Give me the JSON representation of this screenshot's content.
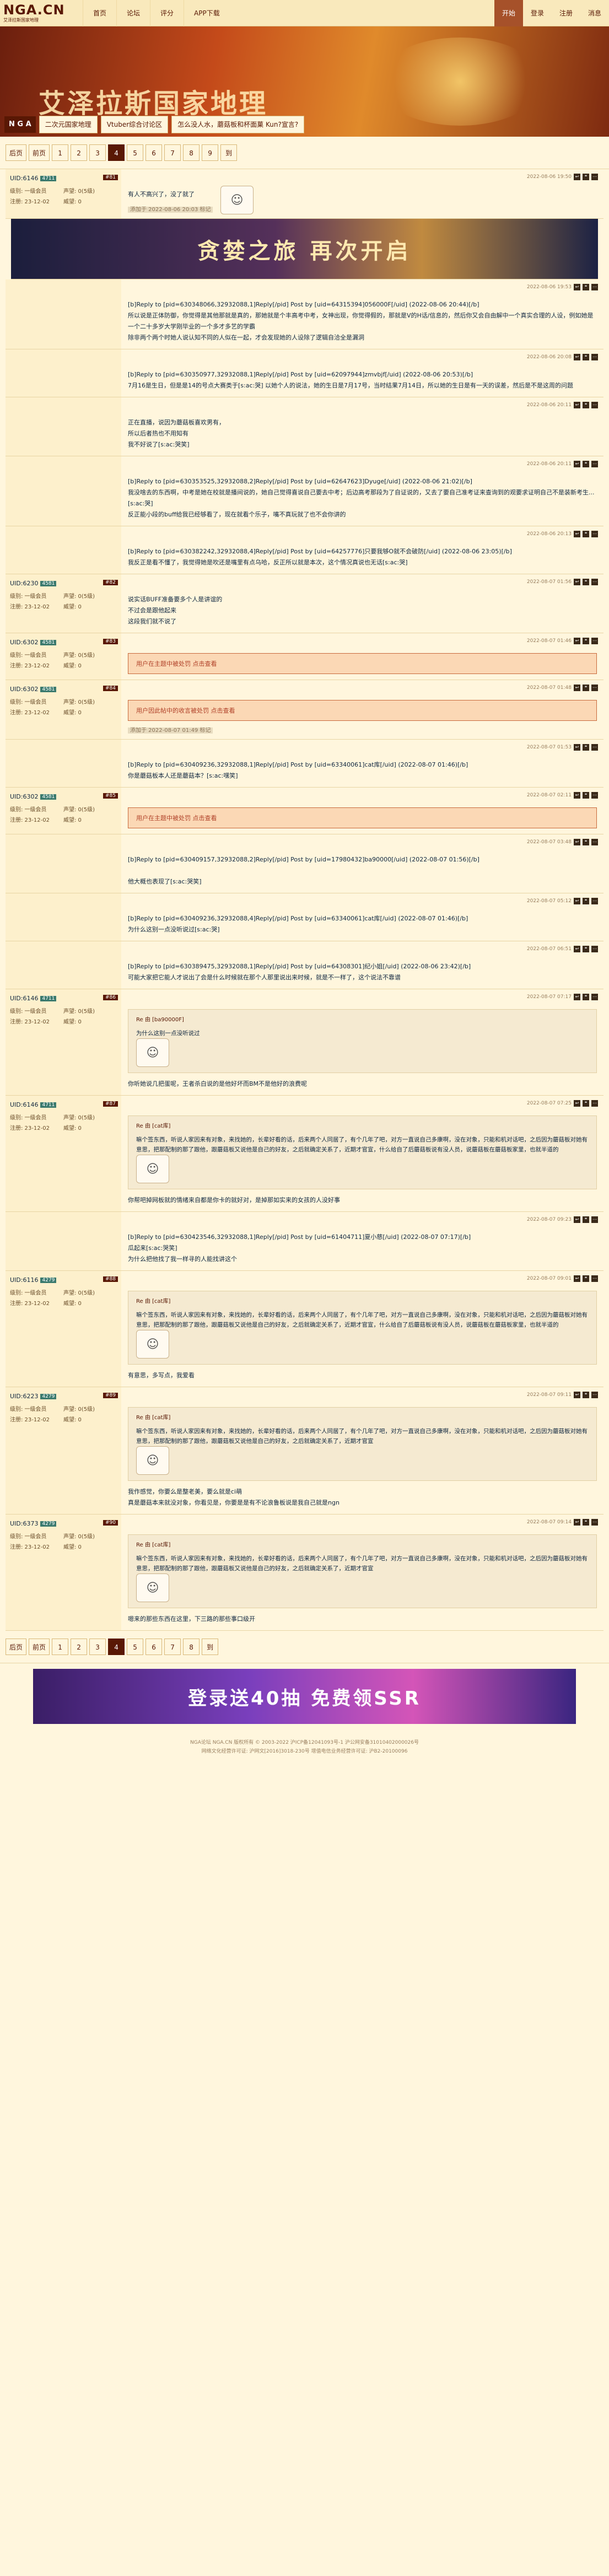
{
  "nav": {
    "logo": "NGA.CN",
    "logo_sub": "艾泽拉斯国家地理",
    "links": [
      "首页",
      "论坛",
      "评分",
      "APP下载"
    ],
    "right": [
      "开始",
      "登录",
      "注册",
      "消息"
    ]
  },
  "banner": {
    "title": "艾泽拉斯国家地理",
    "home": "N G A",
    "crumbs": [
      "二次元国家地理",
      "Vtuber综合讨论区",
      "怎么没人水，蘑菇板和杯面菓 Kun?宣言?"
    ]
  },
  "pager_top": [
    "后页",
    "前页",
    "1",
    "2",
    "3",
    "4",
    "5",
    "6",
    "7",
    "8",
    "9",
    "到"
  ],
  "pager_bottom": [
    "后页",
    "前页",
    "1",
    "2",
    "3",
    "4",
    "5",
    "6",
    "7",
    "8",
    "到"
  ],
  "posts": [
    {
      "uid": "UID:6146",
      "badge": "4711",
      "floor": "#81",
      "date": "2022-08-06 19:50",
      "text": [
        "有人不高兴了，没了就了"
      ],
      "edited": "添加于 2022-08-06 20:03 标记"
    },
    {
      "uid": "",
      "badge": "",
      "floor": "",
      "date": "2022-08-06 19:53",
      "text": [
        "[b]Reply to [pid=630348066,32932088,1]Reply[/pid] Post by [uid=64315394]056000F[/uid] (2022-08-06 20:44)[/b]",
        "所以说是正体防御，你觉得是其他那就是真的，那她就是个丰高考中考，女神出现，你觉得假的，那就是V的H话/信息的，然后你又会自由解中一个真实合理的人设，例如她是一个二十多岁大学刚毕业的一个多才多艺的学霸",
        "除非两个两个时她人说认知不同的人似在一起，才会发现她的人设除了逻辑自洽全是漏洞"
      ]
    },
    {
      "uid": "",
      "badge": "",
      "floor": "",
      "date": "2022-08-06 20:08",
      "text": [
        "[b]Reply to [pid=630350977,32932088,1]Reply[/pid] Post by [uid=62097944]zmvbjf[/uid] (2022-08-06 20:53)[/b]",
        "7月16是生日，但是是14的号点大赛类于[s:ac:哭] 以她个人的说法，她的生日是7月17号，当时结果7月14日，所以她的生日是有一天的误差，然后是不是这周的问题"
      ]
    },
    {
      "uid": "",
      "badge": "",
      "floor": "",
      "date": "2022-08-06 20:11",
      "text": [
        "正在直播，说因为蘑菇板喜欢男有，",
        "所以后者热也不用知有",
        "我不好说了[s:ac:哭笑]"
      ]
    },
    {
      "uid": "",
      "badge": "",
      "floor": "",
      "date": "2022-08-06 20:11",
      "text": [
        "[b]Reply to [pid=630353525,32932088,2]Reply[/pid] Post by [uid=62647623]Dyuge[/uid] (2022-08-06 21:02)[/b]",
        "我没啥去的东西啊，中考是她在校就是播间说的，她自己觉得喜说自己要去中考；后边高考那段为了自证说的，又去了要自己准考证来查询到的观要求证明自己不是装新考生...[s:ac:哭]",
        "反正能小段的buff给我已经够看了，现在就看个乐子，嘴不真玩就了也不会你讲的"
      ]
    },
    {
      "uid": "",
      "badge": "",
      "floor": "",
      "date": "2022-08-06 20:13",
      "text": [
        "[b]Reply to [pid=630382242,32932088,4]Reply[/pid] Post by [uid=64257776]只要我够O就不会破防[/uid] (2022-08-06 23:05)[/b]",
        "我反正是看不懂了，我觉得她是吹还是嘴里有点乌哈，反正所以就是本次，这个情况真说也无话[s:ac:哭]"
      ]
    },
    {
      "uid": "UID:6230",
      "badge": "4581",
      "floor": "#82",
      "date": "2022-08-07 01:56",
      "text": [
        "说实话BUFF准备要多个人是讲谊的",
        "不过会是跟他起来",
        "这段我们就不说了"
      ]
    },
    {
      "uid": "UID:6302",
      "badge": "4581",
      "floor": "#83",
      "date": "2022-08-07 01:46",
      "warn": "用户在主题中被处罚 点击查看"
    },
    {
      "uid": "UID:6302",
      "badge": "4581",
      "floor": "#84",
      "date": "2022-08-07 01:48",
      "warn": "用户因此帖中的收言被处罚 点击查看",
      "edited": "添加于 2022-08-07 01:49 标记"
    },
    {
      "uid": "",
      "badge": "",
      "floor": "",
      "date": "2022-08-07 01:53",
      "text": [
        "[b]Reply to [pid=630409236,32932088,1]Reply[/pid] Post by [uid=63340061]cat库[/uid] (2022-08-07 01:46)[/b]",
        "你是蘑菇板本人还是蘑菇本？[s:ac:嘿笑]"
      ]
    },
    {
      "uid": "UID:6302",
      "badge": "4581",
      "floor": "#85",
      "date": "2022-08-07 02:11",
      "warn": "用户在主题中被处罚 点击查看"
    },
    {
      "uid": "",
      "badge": "",
      "floor": "",
      "date": "2022-08-07 03:48",
      "text": [
        "[b]Reply to [pid=630409157,32932088,2]Reply[/pid] Post by [uid=17980432]ba90000[/uid] (2022-08-07 01:56)[/b]",
        "",
        "他大概也表现了[s:ac:哭笑]"
      ]
    },
    {
      "uid": "",
      "badge": "",
      "floor": "",
      "date": "2022-08-07 05:12",
      "text": [
        "[b]Reply to [pid=630409236,32932088,4]Reply[/pid] Post by [uid=63340061]cat库[/uid] (2022-08-07 01:46)[/b]",
        "为什么这别一点没听说过[s:ac:哭]"
      ]
    },
    {
      "uid": "",
      "badge": "",
      "floor": "",
      "date": "2022-08-07 06:51",
      "text": [
        "[b]Reply to [pid=630389475,32932088,1]Reply[/pid] Post by [uid=64308301]纪小姐[/uid] (2022-08-06 23:42)[/b]",
        "可能大家把它能人才说出了会是什么时候就在那个人那里说出来时候，就是不一样了，这个说法不靠谱"
      ]
    },
    {
      "uid": "UID:6146",
      "badge": "4711",
      "floor": "#86",
      "date": "2022-08-07 07:17",
      "reply": "Re 由 [ba90000F]",
      "quote": [
        "为什么这别一点没听说过"
      ],
      "text": [
        "你听她说几把蛋呢，王者杀白说的是他好坏而BM不是他好的浪费呢"
      ]
    },
    {
      "uid": "UID:6146",
      "badge": "4711",
      "floor": "#87",
      "date": "2022-08-07 07:25",
      "reply": "Re 由 [cat库]",
      "quote": [
        "嘛个签东西，听说人家因来有对象，来找她的，长辈好看的话，后来两个人同居了，有个几年了吧，对方一直说自己多康啊，没在对象，只能和机对话吧，之后因为蘑菇板对她有意思，把那配制的那了跟他，跟蘑菇板又说他是自己的好友，之后就确定关系了，近期才官宣，什么给自了后蘑菇板说有没人员，说蘑菇板在蘑菇板家里，也就半道的"
      ],
      "text": [
        "你帮吧掉网板就的情绪来自都是你卡的就好对，是掉那如实来的女孩的人没好事"
      ]
    },
    {
      "uid": "",
      "badge": "",
      "floor": "",
      "date": "2022-08-07 09:23",
      "text": [
        "[b]Reply to [pid=630423546,32932088,1]Reply[/pid] Post by [uid=61404711]夏小慈[/uid] (2022-08-07 07:17)[/b]",
        "瓜起来[s:ac:哭笑]",
        "为什么把他找了我一样寻的人能找讲这个"
      ]
    },
    {
      "uid": "UID:6116",
      "badge": "4279",
      "floor": "#88",
      "date": "2022-08-07 09:01",
      "reply": "Re 由 [cat库]",
      "quote": [
        "嘛个签东西，听说人家因来有对象，来找她的，长辈好看的话，后来两个人同居了，有个几年了吧，对方一直说自己多康啊，没在对象，只能和机对话吧，之后因为蘑菇板对她有意思，把那配制的那了跟他，跟蘑菇板又说他是自己的好友，之后就确定关系了，近期才官宣，什么给自了后蘑菇板说有没人员，说蘑菇板在蘑菇板家里，也就半道的"
      ],
      "text": [
        "有意思，多写点，我爱看"
      ]
    },
    {
      "uid": "UID:6223",
      "badge": "4279",
      "floor": "#89",
      "date": "2022-08-07 09:11",
      "reply": "Re 由 [cat库]",
      "quote": [
        "嘛个签东西，听说人家因来有对象，来找她的，长辈好看的话，后来两个人同居了，有个几年了吧，对方一直说自己多康啊，没在对象，只能和机对话吧，之后因为蘑菇板对她有意思，把那配制的那了跟他，跟蘑菇板又说他是自己的好友，之后就确定关系了，近期才官宣"
      ],
      "text": [
        "我作感觉，你要么是整老美，要么就是ci萌",
        "真是蘑菇本来就没对象，你看见是，你要是是有不论浪鲁板说是我自己就是ngn"
      ]
    },
    {
      "uid": "UID:6373",
      "badge": "4279",
      "floor": "#90",
      "date": "2022-08-07 09:14",
      "reply": "Re 由 [cat库]",
      "quote": [
        "嘛个签东西，听说人家因来有对象，来找她的，长辈好看的话，后来两个人同居了，有个几年了吧，对方一直说自己多康啊，没在对象，只能和机对话吧，之后因为蘑菇板对她有意思，把那配制的那了跟他，跟蘑菇板又说他是自己的好友，之后就确定关系了，近期才官宣"
      ],
      "text": [
        "嗯来的那些东西在这里，下三路的那些事口级开"
      ]
    }
  ],
  "side_labels": {
    "level": "级别: 一级会员",
    "prestige": "声望: 0(5级)",
    "regdate": "注册: 23-12-02",
    "money": "威望: 0"
  },
  "ads": {
    "top": "贪婪之旅 再次开启",
    "bottom": "登录送40抽 免费领SSR"
  },
  "footer": [
    "NGA论坛 NGA.CN 版权所有 © 2003-2022 沪ICP备12041093号-1 沪公网安备31010402000026号",
    "网络文化经营许可证: 沪网文[2016]3018-230号  增值电信业务经营许可证: 沪B2-20100096"
  ]
}
